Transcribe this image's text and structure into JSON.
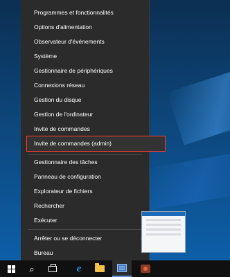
{
  "menu": {
    "items": [
      {
        "label": "Programmes et fonctionnalités"
      },
      {
        "label": "Options d'alimentation"
      },
      {
        "label": "Observateur d'événements"
      },
      {
        "label": "Système"
      },
      {
        "label": "Gestionnaire de périphériques"
      },
      {
        "label": "Connexions réseau"
      },
      {
        "label": "Gestion du disque"
      },
      {
        "label": "Gestion de l'ordinateur"
      },
      {
        "label": "Invite de commandes"
      },
      {
        "label": "Invite de commandes (admin)"
      },
      {
        "label": "Gestionnaire des tâches"
      },
      {
        "label": "Panneau de configuration"
      },
      {
        "label": "Explorateur de fichiers"
      },
      {
        "label": "Rechercher"
      },
      {
        "label": "Exécuter"
      },
      {
        "label": "Arrêter ou se déconnecter"
      },
      {
        "label": "Bureau"
      }
    ],
    "submenu_chevron": "›",
    "highlight_color": "#ff3b30"
  },
  "taskbar": {
    "icons": [
      "windows-start-icon",
      "search-icon",
      "task-view-icon",
      "internet-explorer-icon",
      "file-explorer-icon",
      "server-manager-icon",
      "tool-app-icon"
    ],
    "search_glyph": "⌕",
    "ie_glyph": "e"
  }
}
